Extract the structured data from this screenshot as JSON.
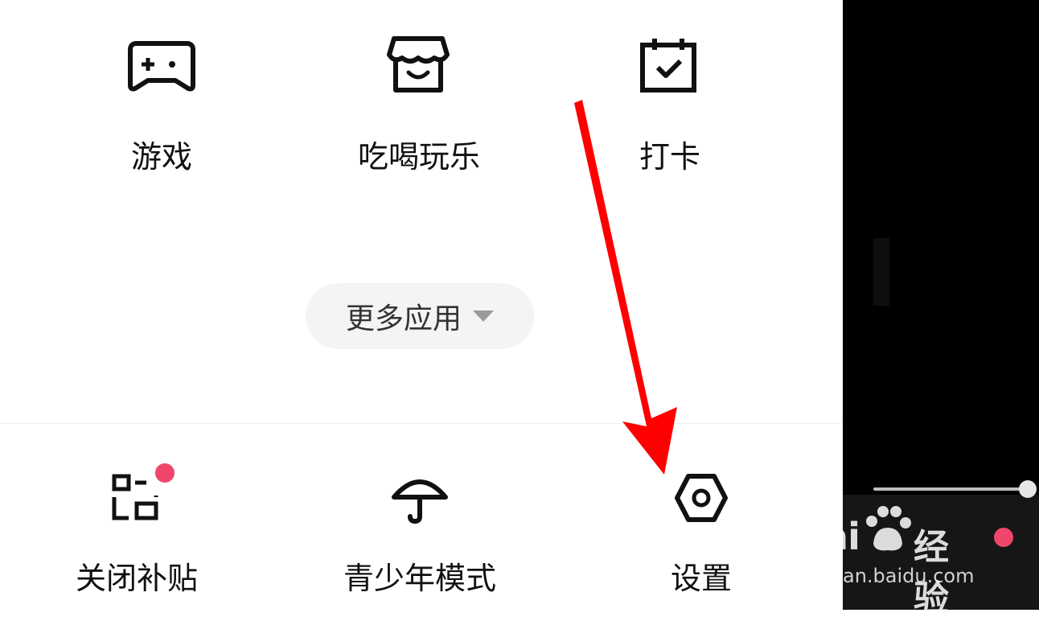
{
  "apps": [
    {
      "label": "游戏",
      "icon": "gamepad-icon"
    },
    {
      "label": "吃喝玩乐",
      "icon": "store-icon"
    },
    {
      "label": "打卡",
      "icon": "calendar-check-icon"
    }
  ],
  "more_button": {
    "label": "更多应用",
    "icon": "caret-down-icon"
  },
  "bottom_items": [
    {
      "label": "关闭补贴",
      "icon": "subsidy-icon",
      "badge": true
    },
    {
      "label": "青少年模式",
      "icon": "umbrella-icon"
    },
    {
      "label": "设置",
      "icon": "hex-nut-icon"
    }
  ],
  "watermark": {
    "brand": "Bai",
    "brand2": "经验",
    "url": "jingyan.baidu.com"
  },
  "colors": {
    "accent": "#f0466b",
    "arrow": "#ff0000",
    "text": "#111111"
  }
}
